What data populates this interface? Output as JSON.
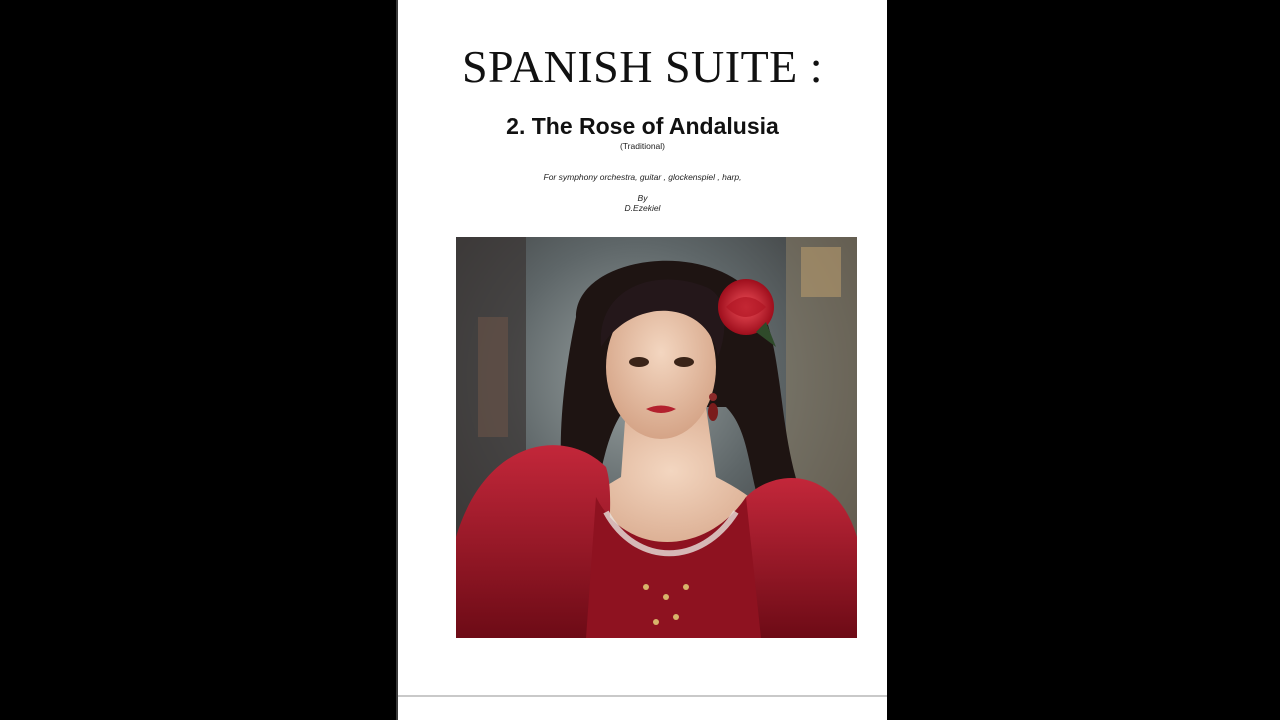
{
  "document": {
    "title": "SPANISH SUITE :",
    "subtitle": "2. The Rose of Andalusia",
    "origin_note": "(Traditional)",
    "instrumentation": "For symphony orchestra, guitar , glockenspiel , harp,",
    "by_label": "By",
    "author": "D.Ezekiel"
  },
  "artwork": {
    "description_icon": "portrait-painting",
    "colors": {
      "background": "#4a4f52",
      "dress": "#9b1422",
      "rose": "#d3202a",
      "hair": "#1e1412",
      "skin": "#e8c3a8"
    }
  },
  "colors": {
    "letterbox": "#000000",
    "page": "#ffffff",
    "text": "#111111"
  }
}
